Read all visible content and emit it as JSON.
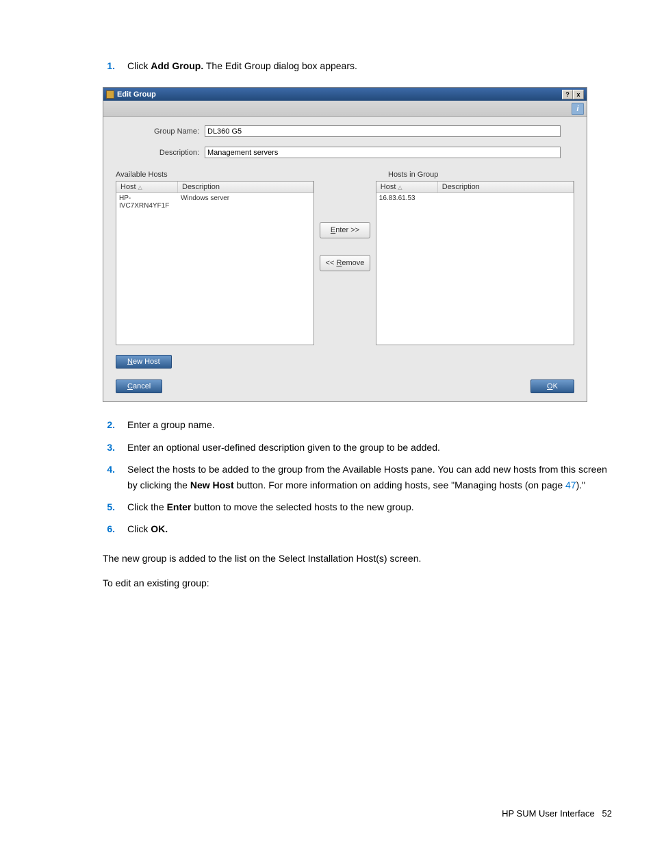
{
  "steps_before": [
    {
      "num": "1.",
      "before": "Click ",
      "bold": "Add Group.",
      "after": " The Edit Group dialog box appears."
    }
  ],
  "dialog": {
    "title": "Edit Group",
    "help_btn": "?",
    "close_btn": "x",
    "mini_help": "i",
    "group_name_label": "Group Name:",
    "group_name_value": "DL360 G5",
    "description_label": "Description:",
    "description_value": "Management servers",
    "available_hosts_label": "Available Hosts",
    "hosts_in_group_label": "Hosts in Group",
    "col_host": "Host",
    "col_description": "Description",
    "available_rows": [
      {
        "host": "HP-IVC7XRN4YF1F",
        "desc": "Windows server"
      }
    ],
    "in_group_rows": [
      {
        "host": "16.83.61.53",
        "desc": ""
      }
    ],
    "enter_btn": "Enter >>",
    "remove_btn": "<< Remove",
    "new_host_btn": "New Host",
    "cancel_btn": "Cancel",
    "ok_btn": "OK"
  },
  "steps_after": [
    {
      "num": "2.",
      "text": "Enter a group name."
    },
    {
      "num": "3.",
      "text": "Enter an optional user-defined description given to the group to be added."
    },
    {
      "num": "4.",
      "before": "Select the hosts to be added to the group from the Available Hosts pane. You can add new hosts from this screen by clicking the ",
      "bold": "New Host",
      "after": " button. For more information on adding hosts, see \"Managing hosts (on page ",
      "link": "47",
      "after2": ").\""
    },
    {
      "num": "5.",
      "before": "Click the ",
      "bold": "Enter",
      "after": " button to move the selected hosts to the new group."
    },
    {
      "num": "6.",
      "before": "Click ",
      "bold": "OK.",
      "after": ""
    }
  ],
  "paragraphs": [
    "The new group is added to the list on the Select Installation Host(s) screen.",
    "To edit an existing group:"
  ],
  "footer_text": "HP SUM User Interface",
  "footer_page": "52"
}
